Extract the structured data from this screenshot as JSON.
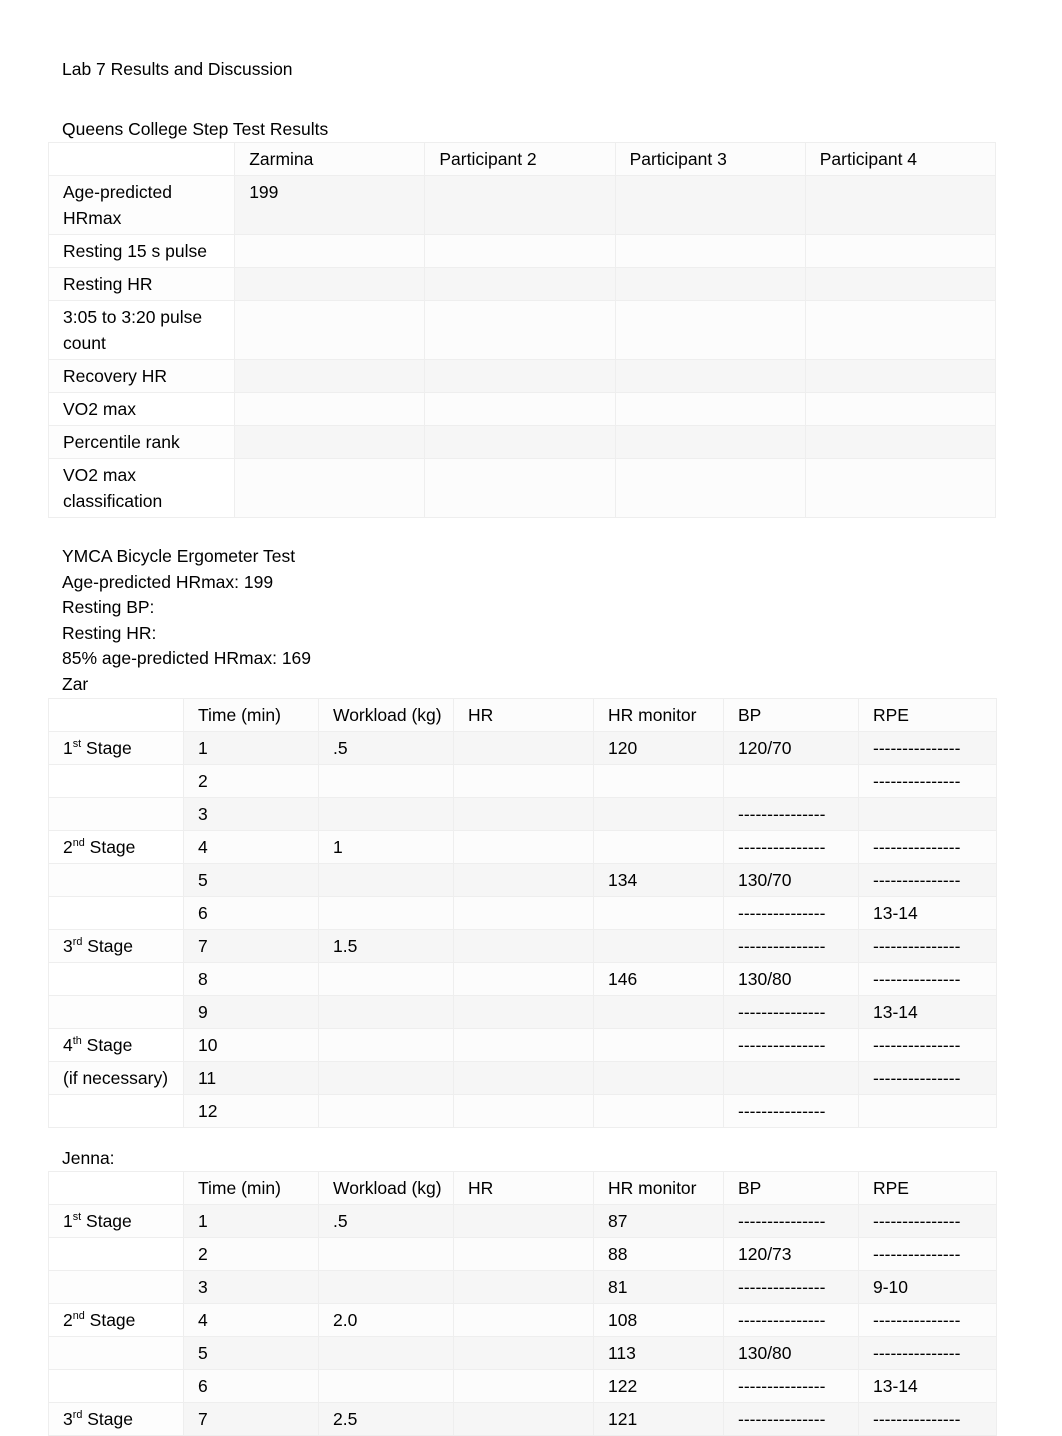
{
  "document": {
    "title": "Lab 7 Results and Discussion"
  },
  "step_test": {
    "heading": "Queens College Step Test Results",
    "columns": [
      "",
      "Zarmina",
      "Participant 2",
      "Participant 3",
      "Participant 4"
    ],
    "rows": [
      {
        "label": "Age-predicted HRmax",
        "values": [
          "199",
          "",
          "",
          ""
        ]
      },
      {
        "label": "Resting 15 s pulse",
        "values": [
          "",
          "",
          "",
          ""
        ]
      },
      {
        "label": "Resting HR",
        "values": [
          "",
          "",
          "",
          ""
        ]
      },
      {
        "label": "3:05 to 3:20 pulse count",
        "values": [
          "",
          "",
          "",
          ""
        ]
      },
      {
        "label": "Recovery HR",
        "values": [
          "",
          "",
          "",
          ""
        ]
      },
      {
        "label": "VO2 max",
        "values": [
          "",
          "",
          "",
          ""
        ]
      },
      {
        "label": "Percentile rank",
        "values": [
          "",
          "",
          "",
          ""
        ]
      },
      {
        "label": "VO2 max classification",
        "values": [
          "",
          "",
          "",
          ""
        ]
      }
    ]
  },
  "ymca": {
    "heading": "YMCA Bicycle Ergometer Test",
    "age_predicted_hrmax": "Age-predicted HRmax: 199",
    "resting_bp": "Resting BP:",
    "resting_hr": "Resting HR:",
    "hrmax_85": "85% age-predicted HRmax: 169",
    "participant_1_label": "Zar",
    "participant_2_label": "Jenna:",
    "columns": [
      "",
      "Time (min)",
      "Workload (kg)",
      "HR",
      "HR monitor",
      "BP",
      "RPE"
    ],
    "dash": "---------------",
    "zar_rows": [
      {
        "stage": "1st Stage",
        "stage_ord": "st",
        "stage_num": "1",
        "stage_sub": "",
        "time": "1",
        "workload": ".5",
        "hr": "",
        "monitor": "120",
        "bp": "120/70",
        "rpe": "---------------"
      },
      {
        "stage": "",
        "stage_ord": "",
        "stage_num": "",
        "stage_sub": "",
        "time": "2",
        "workload": "",
        "hr": "",
        "monitor": "",
        "bp": "",
        "rpe": "---------------"
      },
      {
        "stage": "",
        "stage_ord": "",
        "stage_num": "",
        "stage_sub": "",
        "time": "3",
        "workload": "",
        "hr": "",
        "monitor": "",
        "bp": "---------------",
        "rpe": ""
      },
      {
        "stage": "2nd Stage",
        "stage_ord": "nd",
        "stage_num": "2",
        "stage_sub": "",
        "time": "4",
        "workload": "1",
        "hr": "",
        "monitor": "",
        "bp": "---------------",
        "rpe": "---------------"
      },
      {
        "stage": "",
        "stage_ord": "",
        "stage_num": "",
        "stage_sub": "",
        "time": "5",
        "workload": "",
        "hr": "",
        "monitor": "134",
        "bp": "130/70",
        "rpe": "---------------"
      },
      {
        "stage": "",
        "stage_ord": "",
        "stage_num": "",
        "stage_sub": "",
        "time": "6",
        "workload": "",
        "hr": "",
        "monitor": "",
        "bp": "---------------",
        "rpe": "13-14"
      },
      {
        "stage": "3rd Stage",
        "stage_ord": "rd",
        "stage_num": "3",
        "stage_sub": "",
        "time": "7",
        "workload": "1.5",
        "hr": "",
        "monitor": "",
        "bp": "---------------",
        "rpe": "---------------"
      },
      {
        "stage": "",
        "stage_ord": "",
        "stage_num": "",
        "stage_sub": "",
        "time": "8",
        "workload": "",
        "hr": "",
        "monitor": "146",
        "bp": "130/80",
        "rpe": "---------------"
      },
      {
        "stage": "",
        "stage_ord": "",
        "stage_num": "",
        "stage_sub": "",
        "time": "9",
        "workload": "",
        "hr": "",
        "monitor": "",
        "bp": "---------------",
        "rpe": "13-14"
      },
      {
        "stage": "4th Stage",
        "stage_ord": "th",
        "stage_num": "4",
        "stage_sub": "",
        "time": "10",
        "workload": "",
        "hr": "",
        "monitor": "",
        "bp": "---------------",
        "rpe": "---------------"
      },
      {
        "stage": "",
        "stage_ord": "",
        "stage_num": "",
        "stage_sub": "(if necessary)",
        "time": "11",
        "workload": "",
        "hr": "",
        "monitor": "",
        "bp": "",
        "rpe": "---------------"
      },
      {
        "stage": "",
        "stage_ord": "",
        "stage_num": "",
        "stage_sub": "",
        "time": "12",
        "workload": "",
        "hr": "",
        "monitor": "",
        "bp": "---------------",
        "rpe": ""
      }
    ],
    "jenna_rows": [
      {
        "stage_ord": "st",
        "stage_num": "1",
        "stage_sub": "",
        "time": "1",
        "workload": ".5",
        "hr": "",
        "monitor": "87",
        "bp": "---------------",
        "rpe": "---------------"
      },
      {
        "stage_ord": "",
        "stage_num": "",
        "stage_sub": "",
        "time": "2",
        "workload": "",
        "hr": "",
        "monitor": "88",
        "bp": "120/73",
        "rpe": "---------------"
      },
      {
        "stage_ord": "",
        "stage_num": "",
        "stage_sub": "",
        "time": "3",
        "workload": "",
        "hr": "",
        "monitor": "81",
        "bp": "---------------",
        "rpe": "9-10"
      },
      {
        "stage_ord": "nd",
        "stage_num": "2",
        "stage_sub": "",
        "time": "4",
        "workload": "2.0",
        "hr": "",
        "monitor": "108",
        "bp": "---------------",
        "rpe": "---------------"
      },
      {
        "stage_ord": "",
        "stage_num": "",
        "stage_sub": "",
        "time": "5",
        "workload": "",
        "hr": "",
        "monitor": "113",
        "bp": "130/80",
        "rpe": "---------------"
      },
      {
        "stage_ord": "",
        "stage_num": "",
        "stage_sub": "",
        "time": "6",
        "workload": "",
        "hr": "",
        "monitor": "122",
        "bp": "---------------",
        "rpe": "13-14"
      },
      {
        "stage_ord": "rd",
        "stage_num": "3",
        "stage_sub": "",
        "time": "7",
        "workload": "2.5",
        "hr": "",
        "monitor": "121",
        "bp": "---------------",
        "rpe": "---------------"
      }
    ]
  }
}
